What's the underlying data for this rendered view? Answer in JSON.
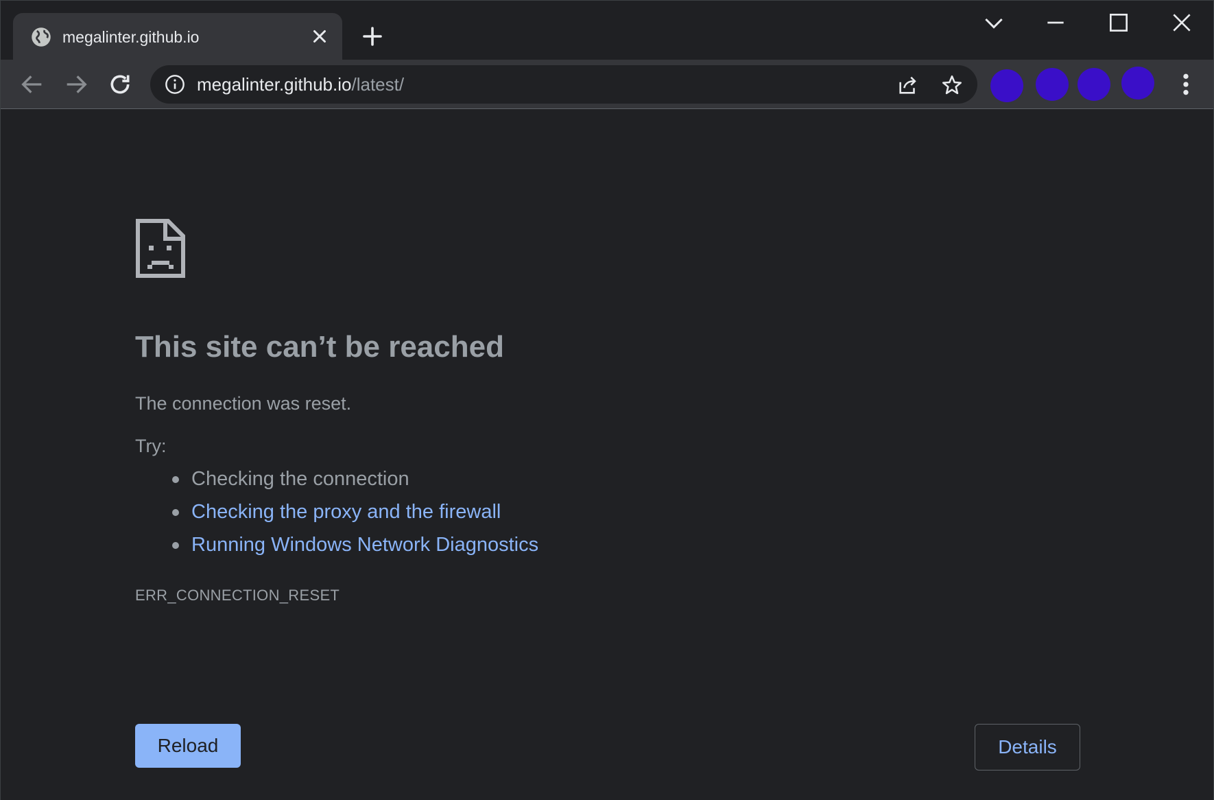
{
  "tab": {
    "title": "megalinter.github.io"
  },
  "omnibox": {
    "host": "megalinter.github.io",
    "path": "/latest/"
  },
  "page": {
    "heading": "This site can’t be reached",
    "subtext": "The connection was reset.",
    "try_label": "Try:",
    "suggestions": [
      {
        "text": "Checking the connection",
        "link": false
      },
      {
        "text": "Checking the proxy and the firewall",
        "link": true
      },
      {
        "text": "Running Windows Network Diagnostics",
        "link": true
      }
    ],
    "error_code": "ERR_CONNECTION_RESET",
    "reload_label": "Reload",
    "details_label": "Details"
  },
  "extensions": {
    "color": "#3a0fc8"
  },
  "colors": {
    "background": "#202124",
    "toolbar": "#35363a",
    "link": "#8ab4f8",
    "muted_text": "#9aa0a6"
  },
  "icons": {
    "tab_favicon": "globe-icon",
    "tab_close": "close-icon",
    "new_tab": "plus-icon",
    "tab_search": "chevron-down-icon",
    "minimize": "minimize-icon",
    "maximize": "maximize-icon",
    "close_window": "close-icon",
    "back": "back-arrow-icon",
    "forward": "forward-arrow-icon",
    "reload": "reload-icon",
    "site_info": "info-icon",
    "share": "share-icon",
    "bookmark": "star-icon",
    "menu": "more-vert-icon",
    "error": "sad-page-icon"
  }
}
